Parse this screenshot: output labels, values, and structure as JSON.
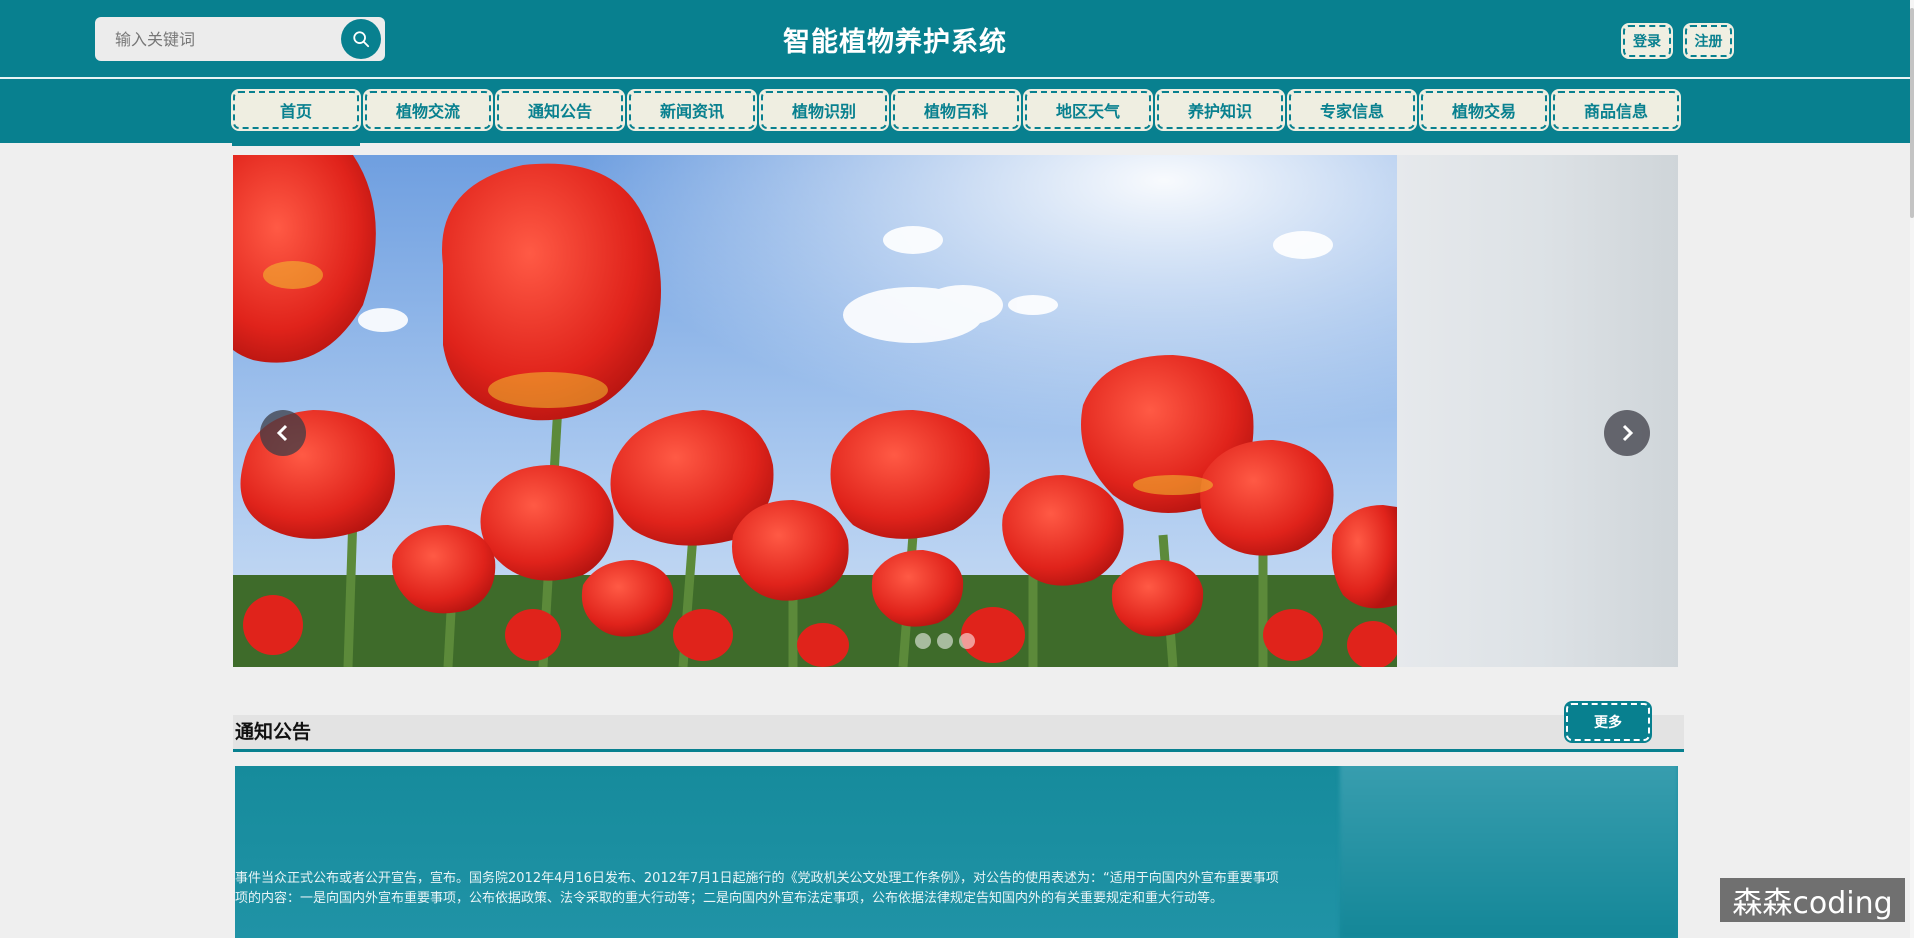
{
  "header": {
    "search": {
      "placeholder": "输入关键词"
    },
    "title": "智能植物养护系统",
    "login_label": "登录",
    "register_label": "注册"
  },
  "nav": {
    "items": [
      {
        "label": "首页"
      },
      {
        "label": "植物交流"
      },
      {
        "label": "通知公告"
      },
      {
        "label": "新闻资讯"
      },
      {
        "label": "植物识别"
      },
      {
        "label": "植物百科"
      },
      {
        "label": "地区天气"
      },
      {
        "label": "养护知识"
      },
      {
        "label": "专家信息"
      },
      {
        "label": "植物交易"
      },
      {
        "label": "商品信息"
      }
    ],
    "active_index": 0
  },
  "carousel": {
    "slide_count": 3,
    "active_slide": 0
  },
  "notice": {
    "title": "通知公告",
    "more_label": "更多",
    "text_line_1": "事件当众正式公布或者公开宣告，宣布。国务院2012年4月16日发布、2012年7月1日起施行的《党政机关公文处理工作条例》，对公告的使用表述为：“适用于向国内外宣布重要事项",
    "text_line_2": "项的内容：一是向国内外宣布重要事项，公布依据政策、法令采取的重大行动等；二是向国内外宣布法定事项，公布依据法律规定告知国内外的有关重要规定和重大行动等。"
  },
  "watermark": "森森coding",
  "colors": {
    "primary": "#08808f",
    "button_bg": "#efeee1",
    "page_bg": "#efefef"
  },
  "icons": {
    "search": "search-icon",
    "prev": "chevron-left-icon",
    "next": "chevron-right-icon"
  }
}
